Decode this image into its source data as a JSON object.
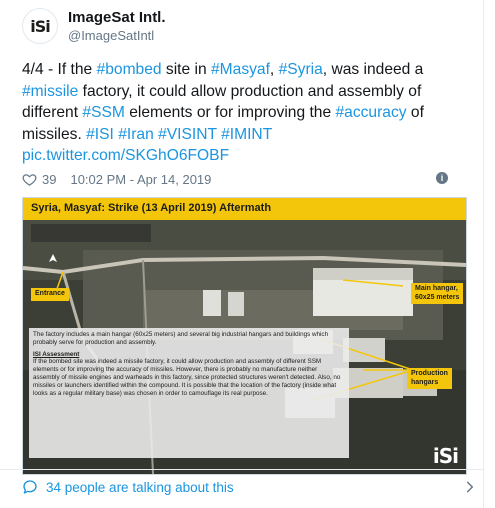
{
  "author": {
    "name": "ImageSat Intl.",
    "handle": "@ImageSatIntl",
    "avatar_text": "iSi"
  },
  "tweet": {
    "segments": [
      {
        "text": "4/4 - If the ",
        "link": false
      },
      {
        "text": "#bombed",
        "link": true
      },
      {
        "text": " site in ",
        "link": false
      },
      {
        "text": "#Masyaf",
        "link": true
      },
      {
        "text": ", ",
        "link": false
      },
      {
        "text": "#Syria",
        "link": true
      },
      {
        "text": ", was indeed a ",
        "link": false
      },
      {
        "text": "#missile",
        "link": true
      },
      {
        "text": " factory, it could allow production and assembly of different ",
        "link": false
      },
      {
        "text": "#SSM",
        "link": true
      },
      {
        "text": " elements or for improving the ",
        "link": false
      },
      {
        "text": "#accuracy",
        "link": true
      },
      {
        "text": " of missiles. ",
        "link": false
      },
      {
        "text": "#ISI",
        "link": true
      },
      {
        "text": " ",
        "link": false
      },
      {
        "text": "#Iran",
        "link": true
      },
      {
        "text": " ",
        "link": false
      },
      {
        "text": "#VISINT",
        "link": true
      },
      {
        "text": " ",
        "link": false
      },
      {
        "text": "#IMINT",
        "link": true
      },
      {
        "text": " ",
        "link": false
      },
      {
        "text": "pic.twitter.com/SKGhO6FOBF",
        "link": true
      }
    ]
  },
  "media": {
    "title": "Syria, Masyaf: Strike (13 April 2019) Aftermath",
    "callouts": {
      "entrance": "Entrance",
      "main_hangar": "Main hangar,\n60x25 meters",
      "production": "Production\nhangars"
    },
    "assessment": {
      "intro": "The factory includes a main hangar (60x25 meters) and several big industrial hangars and buildings which probably serve for production and assembly.",
      "heading": "ISI Assessment",
      "body": "If the bombed site was indeed a missile factory, it could allow production and assembly of different SSM elements or for improving the accuracy of missiles. However, there is probably no manufacture neither assembly of missile engines and warheads in this factory, since protected structures weren't detected. Also, no missiles or launchers identified within the compound. It is possible that the location of the factory (inside what looks as a regular military base) was chosen in order to camouflage its real purpose."
    },
    "logo_text": "iSi"
  },
  "meta": {
    "likes": "39",
    "timestamp": "10:02 PM - Apr 14, 2019"
  },
  "footer": {
    "talking": "34 people are talking about this"
  },
  "colors": {
    "link": "#1b95e0",
    "banner": "#f4c60b",
    "muted": "#657786"
  }
}
